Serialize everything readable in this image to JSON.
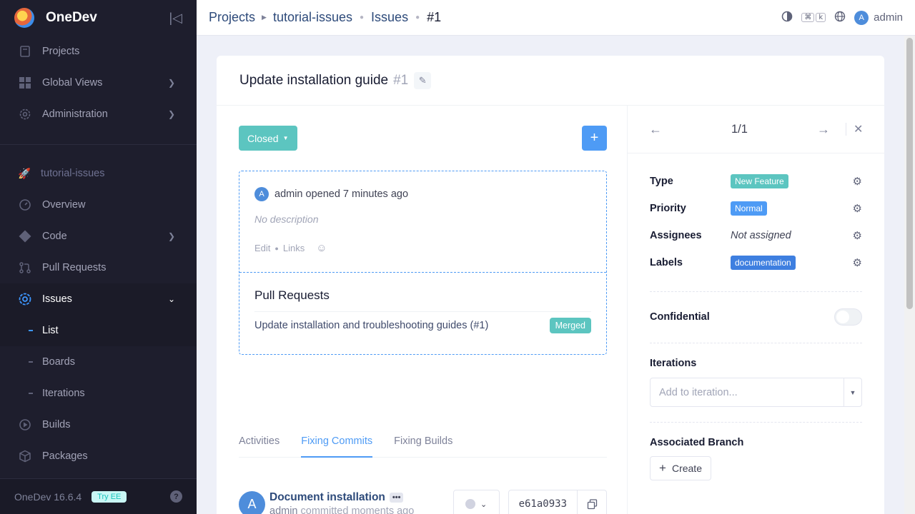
{
  "app": {
    "name": "OneDev",
    "version": "OneDev 16.6.4",
    "try_ee": "Try EE"
  },
  "sidebar": {
    "main_items": [
      {
        "label": "Projects",
        "icon": "projects-icon"
      },
      {
        "label": "Global Views",
        "icon": "grid-icon"
      },
      {
        "label": "Administration",
        "icon": "gear-icon"
      }
    ],
    "project_name": "tutorial-issues",
    "project_items": [
      {
        "label": "Overview"
      },
      {
        "label": "Code"
      },
      {
        "label": "Pull Requests"
      },
      {
        "label": "Issues"
      },
      {
        "label": "List"
      },
      {
        "label": "Boards"
      },
      {
        "label": "Iterations"
      },
      {
        "label": "Builds"
      },
      {
        "label": "Packages"
      }
    ]
  },
  "header": {
    "breadcrumb": [
      "Projects",
      "tutorial-issues",
      "Issues",
      "#1"
    ],
    "user": "admin",
    "user_initial": "A",
    "shortcut_keys": [
      "⌘",
      "k"
    ]
  },
  "issue": {
    "title": "Update installation guide",
    "number": "#1",
    "state": "Closed",
    "opener_text": "admin opened 7 minutes ago",
    "opener_initial": "A",
    "no_description": "No description",
    "actions": [
      "Edit",
      "Links"
    ],
    "pull_requests_title": "Pull Requests",
    "pull_request": "Update installation and troubleshooting guides (#1)",
    "pull_request_status": "Merged"
  },
  "tabs": [
    "Activities",
    "Fixing Commits",
    "Fixing Builds"
  ],
  "commit": {
    "initial": "A",
    "message": "Document installation",
    "author": "admin",
    "meta": "committed moments ago",
    "hash": "e61a0933"
  },
  "side_panel": {
    "pager": "1/1",
    "type_label": "Type",
    "type_value": "New Feature",
    "priority_label": "Priority",
    "priority_value": "Normal",
    "assignees_label": "Assignees",
    "assignees_value": "Not assigned",
    "labels_label": "Labels",
    "labels_value": "documentation",
    "confidential_label": "Confidential",
    "iterations_title": "Iterations",
    "iteration_placeholder": "Add to iteration...",
    "branch_title": "Associated Branch",
    "create_label": "Create"
  },
  "colors": {
    "accent": "#4e9bf5",
    "teal": "#5cc5c0",
    "sidebar_bg": "#1e1e2d"
  }
}
